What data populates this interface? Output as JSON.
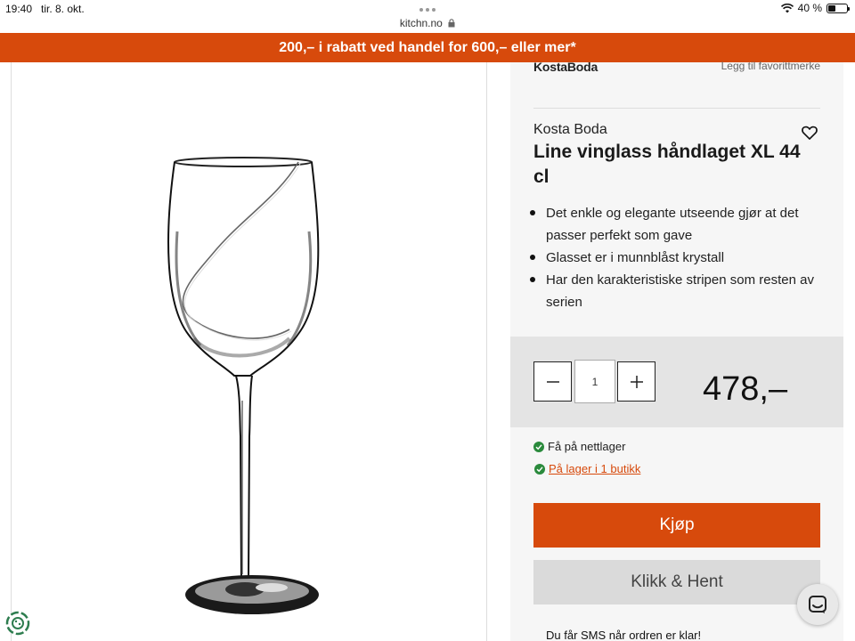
{
  "status_bar": {
    "time": "19:40",
    "date": "tir. 8. okt.",
    "battery": "40 %",
    "battery_level": 0.4
  },
  "browser": {
    "url": "kitchn.no"
  },
  "promo": {
    "text": "200,– i rabatt ved handel for 600,– eller mer*"
  },
  "product": {
    "brand_logo": "KostaBoda",
    "favorite_link": "Legg til favorittmerke",
    "brand": "Kosta Boda",
    "title": "Line vinglass håndlaget XL 44 cl",
    "bullets": [
      "Det enkle og elegante utseende gjør at det passer perfekt som gave",
      "Glasset er i munnblåst krystall",
      "Har den karakteristiske stripen som resten av serien"
    ],
    "quantity": "1",
    "price": "478,–",
    "stock_online": "Få på nettlager",
    "stock_store": "På lager i 1 butikk",
    "buy_label": "Kjøp",
    "click_collect_label": "Klikk & Hent",
    "sms_note": "Du får SMS når ordren er klar!"
  },
  "colors": {
    "accent": "#d74a0c",
    "stock_green": "#2a8a3c",
    "panel_bg": "#f6f6f6"
  }
}
